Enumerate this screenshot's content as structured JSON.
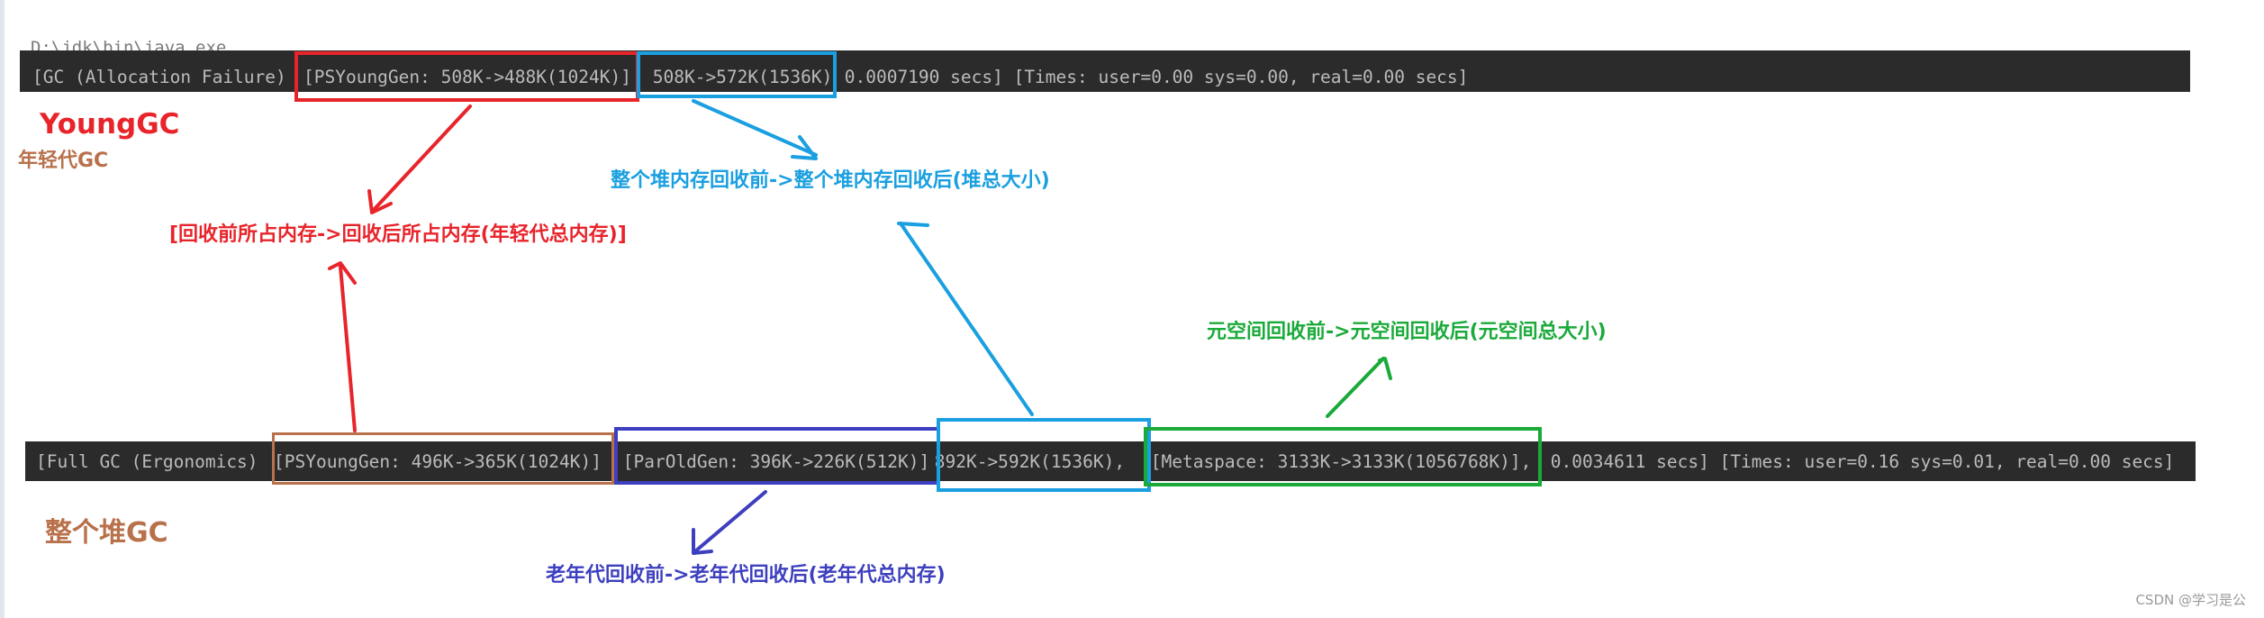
{
  "console": {
    "prev_line": "D:\\jdk\\bin\\java.exe ...",
    "young_log": {
      "gc_prefix": "[GC (Allocation Failure) ",
      "young_gen": "[PSYoungGen: 508K->488K(1024K)]",
      "heap": " 508K->572K(1536K)",
      "suffix": " 0.0007190 secs] [Times: user=0.00 sys=0.00, real=0.00 secs]"
    },
    "full_log": {
      "gc_prefix": "[Full GC (Ergonomics) ",
      "young_gen": "[PSYoungGen: 496K->365K(1024K)]",
      "old_gen": " [ParOldGen: 396K->226K(512K)]",
      "heap": " 892K->592K(1536K),",
      "metaspace": " [Metaspace: 3133K->3133K(1056768K)],",
      "suffix": " 0.0034611 secs] [Times: user=0.16 sys=0.01, real=0.00 secs]"
    }
  },
  "annotations": {
    "young_gc_title": "YoungGC",
    "young_gc_subtitle": "年轻代GC",
    "young_gen_note": "[回收前所占内存->回收后所占内存(年轻代总内存)]",
    "heap_note": "整个堆内存回收前->整个堆内存回收后(堆总大小)",
    "metaspace_note": "元空间回收前->元空间回收后(元空间总大小)",
    "full_gc_title": "整个堆GC",
    "old_gen_note": "老年代回收前->老年代回收后(老年代总内存)"
  },
  "colors": {
    "red": "#e8242b",
    "blue": "#1a9fe0",
    "green": "#1aaa3a",
    "brown": "#b8714a",
    "indigo": "#3d3fbf",
    "console_bg": "#2b2b2b",
    "console_text": "#bbbbbb"
  },
  "watermark": "CSDN @学习是公"
}
